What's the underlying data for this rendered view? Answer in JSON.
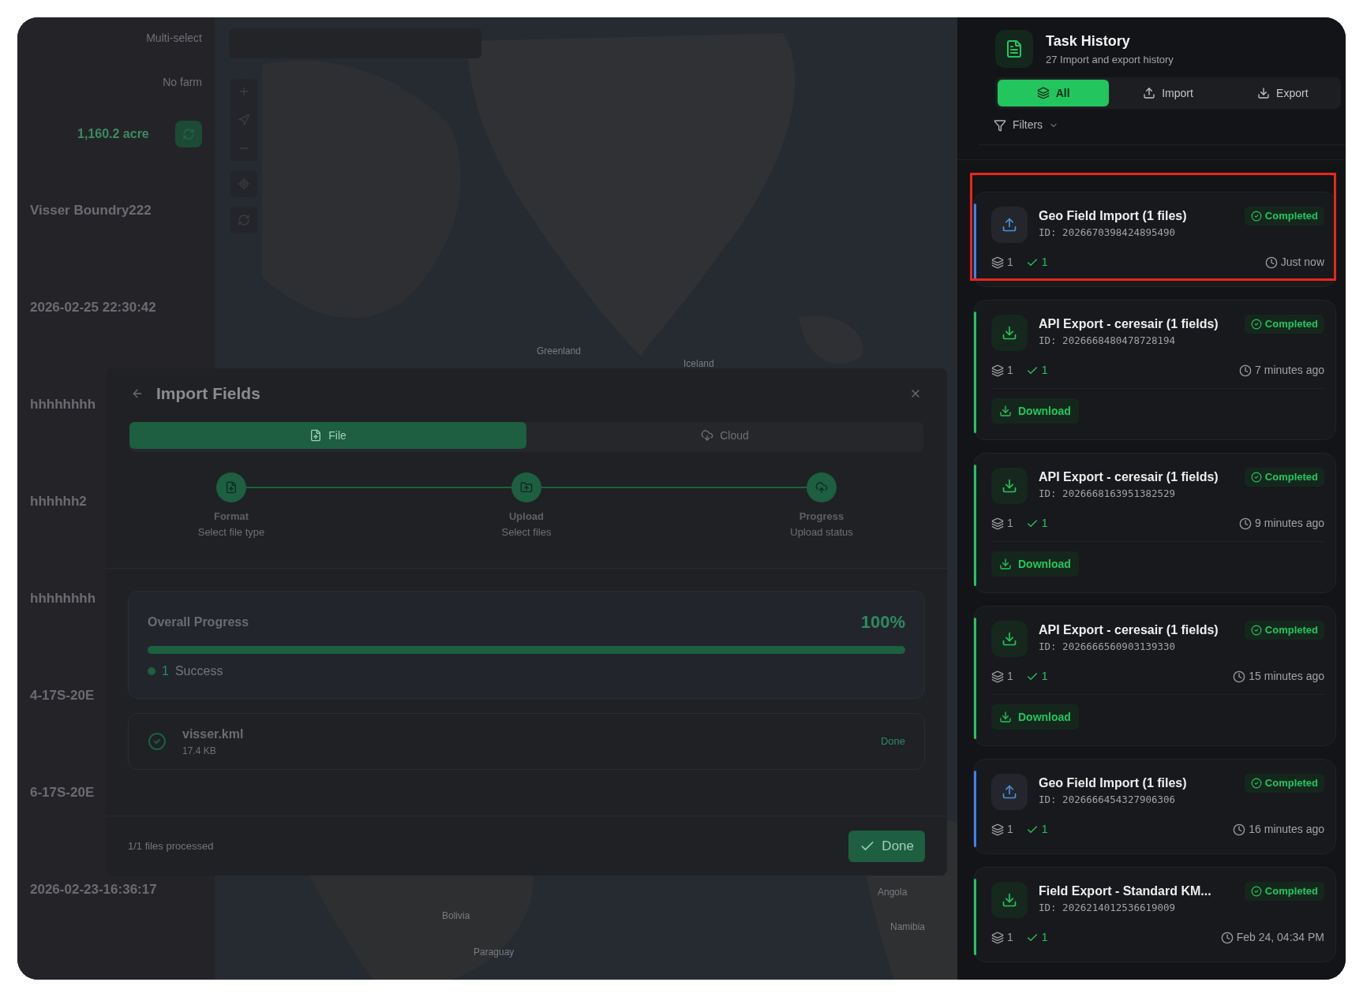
{
  "sidebar": {
    "multi_select": "Multi-select",
    "farm": "No farm",
    "area_total": "1,160.2 acre",
    "items": [
      {
        "name": "Visser Boundry222"
      },
      {
        "name": "2026-02-25 22:30:42"
      },
      {
        "name": "hhhhhhhh"
      },
      {
        "name": "hhhhhh2"
      },
      {
        "name": "hhhhhhhh"
      },
      {
        "name": "4-17S-20E"
      },
      {
        "name": "6-17S-20E"
      },
      {
        "name": "2026-02-23-16:36:17"
      }
    ]
  },
  "map": {
    "labels": [
      "Greenland",
      "Iceland",
      "Bolivia",
      "Paraguay",
      "Angola",
      "Namibia"
    ]
  },
  "import_dialog": {
    "title": "Import Fields",
    "tabs": [
      {
        "label": "File",
        "selected": true
      },
      {
        "label": "Cloud",
        "selected": false
      }
    ],
    "steps": [
      {
        "title": "Format",
        "subtitle": "Select file type",
        "done": true
      },
      {
        "title": "Upload",
        "subtitle": "Select files",
        "done": true
      },
      {
        "title": "Progress",
        "subtitle": "Upload status",
        "done": true
      }
    ],
    "progress": {
      "label": "Overall Progress",
      "percent": "100%",
      "level": 1,
      "success_count": "1",
      "success_label": "Success"
    },
    "files": [
      {
        "name": "visser.kml",
        "size": "17.4 KB",
        "status": "Done"
      }
    ],
    "footer": "1/1 files processed",
    "done_button": "Done"
  },
  "task_history": {
    "title": "Task History",
    "subtitle": "27 Import and export history",
    "tabs": [
      {
        "label": "All",
        "selected": true
      },
      {
        "label": "Import",
        "selected": false
      },
      {
        "label": "Export",
        "selected": false
      }
    ],
    "filters": "Filters",
    "tasks": [
      {
        "kind": "import",
        "title": "Geo Field Import (1 files)",
        "id": "ID: 2026670398424895490",
        "status": "Completed",
        "files": "1",
        "ok": "1",
        "time": "Just now",
        "highlighted": true
      },
      {
        "kind": "export",
        "title": "API Export - ceresair (1 fields)",
        "id": "ID: 2026668480478728194",
        "status": "Completed",
        "files": "1",
        "ok": "1",
        "time": "7 minutes ago",
        "action": "Download",
        "highlighted": false
      },
      {
        "kind": "export",
        "title": "API Export - ceresair (1 fields)",
        "id": "ID: 2026668163951382529",
        "status": "Completed",
        "files": "1",
        "ok": "1",
        "time": "9 minutes ago",
        "action": "Download",
        "highlighted": false
      },
      {
        "kind": "export",
        "title": "API Export - ceresair (1 fields)",
        "id": "ID: 2026666560903139330",
        "status": "Completed",
        "files": "1",
        "ok": "1",
        "time": "15 minutes ago",
        "action": "Download",
        "highlighted": false
      },
      {
        "kind": "import",
        "title": "Geo Field Import (1 files)",
        "id": "ID: 2026666454327906306",
        "status": "Completed",
        "files": "1",
        "ok": "1",
        "time": "16 minutes ago",
        "highlighted": false
      },
      {
        "kind": "export",
        "title": "Field Export - Standard KM...",
        "id": "ID: 2026214012536619009",
        "status": "Completed",
        "files": "1",
        "ok": "1",
        "time": "Feb 24, 04:34 PM",
        "highlighted": false
      }
    ]
  }
}
